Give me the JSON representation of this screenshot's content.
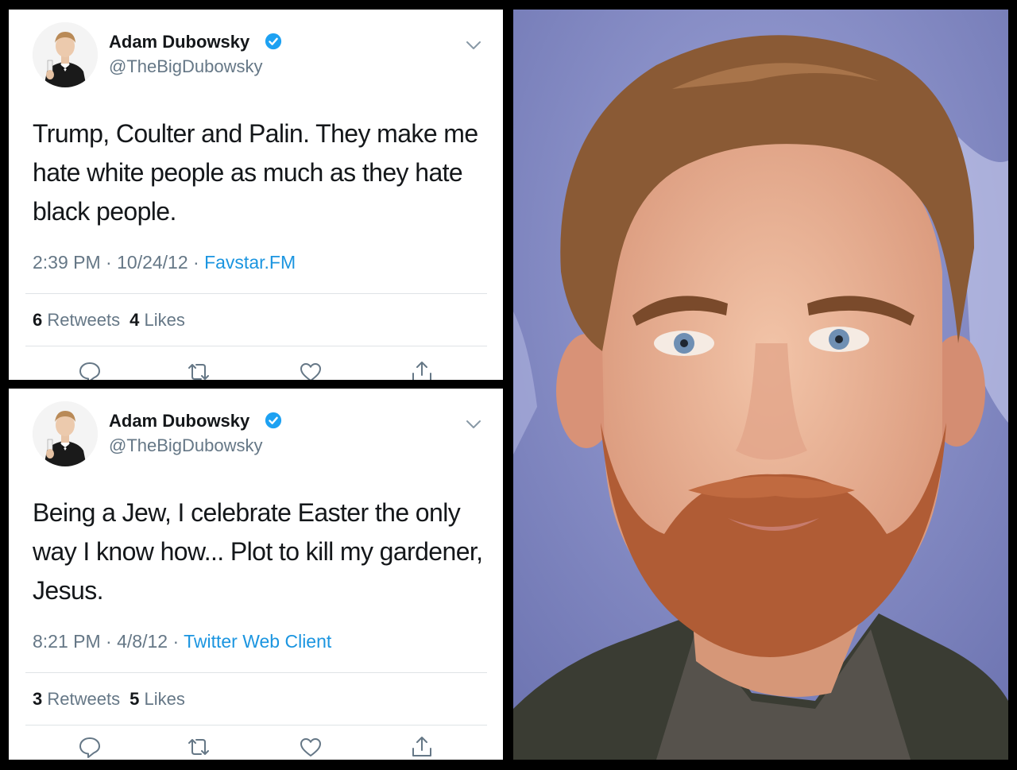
{
  "tweets": [
    {
      "name": "Adam Dubowsky",
      "handle": "@TheBigDubowsky",
      "text": "Trump, Coulter and Palin. They make me hate white people as much as they hate black people.",
      "time": "2:39 PM",
      "date": "10/24/12",
      "source": "Favstar.FM",
      "retweets": "6",
      "retweets_label": "Retweets",
      "likes": "4",
      "likes_label": "Likes"
    },
    {
      "name": "Adam Dubowsky",
      "handle": "@TheBigDubowsky",
      "text": "Being a Jew, I celebrate Easter the only way I know how... Plot to kill my gardener, Jesus.",
      "time": "8:21 PM",
      "date": "4/8/12",
      "source": "Twitter Web Client",
      "retweets": "3",
      "retweets_label": "Retweets",
      "likes": "5",
      "likes_label": "Likes"
    }
  ],
  "meta_separator": " · ",
  "icons": {
    "verified": "verified-badge-icon",
    "more": "chevron-down-icon",
    "reply": "reply-icon",
    "retweet": "retweet-icon",
    "like": "heart-icon",
    "share": "share-icon"
  },
  "colors": {
    "link": "#1b95e0",
    "verified": "#1da1f2",
    "secondary_text": "#657786",
    "primary_text": "#14171a",
    "frame": "#000000"
  }
}
